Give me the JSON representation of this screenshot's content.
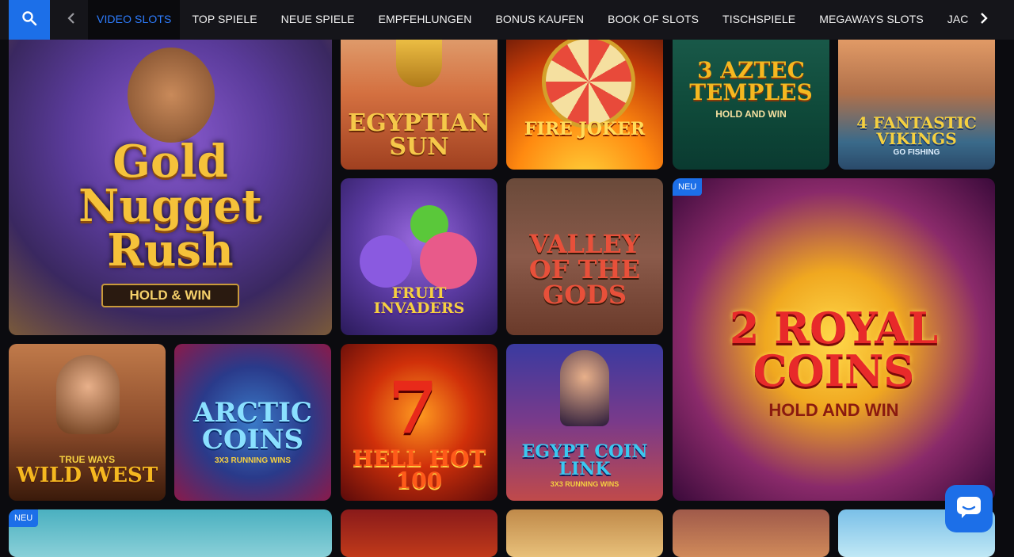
{
  "nav": {
    "tabs": [
      {
        "label": "VIDEO SLOTS",
        "active": true
      },
      {
        "label": "TOP SPIELE"
      },
      {
        "label": "NEUE SPIELE"
      },
      {
        "label": "EMPFEHLUNGEN"
      },
      {
        "label": "BONUS KAUFEN"
      },
      {
        "label": "BOOK OF SLOTS"
      },
      {
        "label": "TISCHSPIELE"
      },
      {
        "label": "MEGAWAYS SLOTS"
      },
      {
        "label": "JACKPOT SLOTS"
      }
    ],
    "search_icon": "search-icon",
    "prev_icon": "chevron-left-icon",
    "next_icon": "chevron-right-icon",
    "accent": "#1c6fe8"
  },
  "games": [
    {
      "title": "Gold Nugget Rush",
      "tagline": "HOLD & WIN"
    },
    {
      "title": "EGYPTIAN SUN"
    },
    {
      "title": "FIRE JOKER"
    },
    {
      "title": "3 AZTEC TEMPLES",
      "tagline": "HOLD AND WIN"
    },
    {
      "title": "4 FANTASTIC VIKINGS",
      "tagline": "GO FISHING"
    },
    {
      "title": "FRUIT INVADERS"
    },
    {
      "title": "VALLEY OF THE GODS"
    },
    {
      "title": "2 ROYAL COINS",
      "tagline": "HOLD AND WIN",
      "badge": "NEU"
    },
    {
      "title": "WILD WEST",
      "tagline": "TRUE WAYS"
    },
    {
      "title": "ARCTIC COINS",
      "tagline": "3X3 RUNNING WINS"
    },
    {
      "title": "HELL HOT 100"
    },
    {
      "title": "EGYPT COIN LINK",
      "tagline": "3X3 RUNNING WINS"
    },
    {
      "badge": "NEU"
    },
    {},
    {},
    {},
    {}
  ],
  "chat": {
    "icon": "chat-icon"
  }
}
